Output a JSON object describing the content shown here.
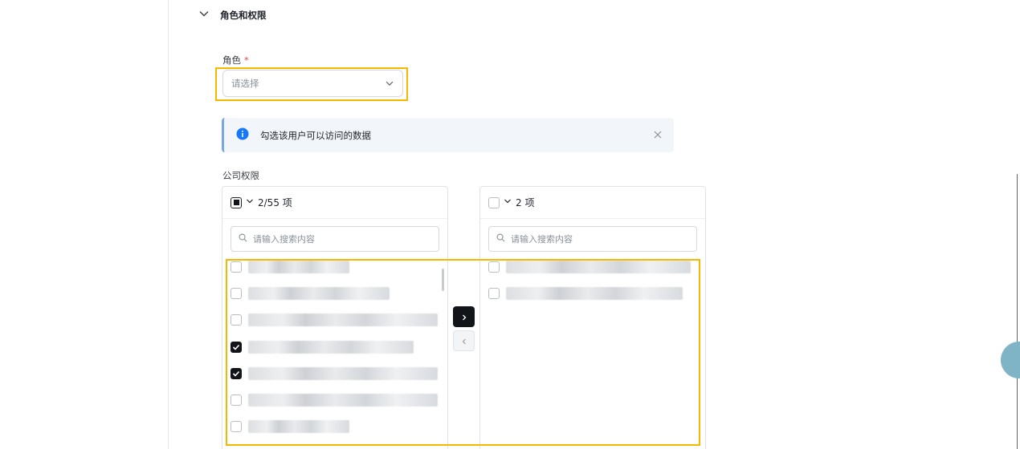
{
  "section": {
    "title": "角色和权限"
  },
  "role": {
    "label": "角色",
    "required_mark": "*",
    "placeholder": "请选择"
  },
  "alert": {
    "text": "勾选该用户可以访问的数据"
  },
  "company_permissions": {
    "label": "公司权限",
    "source": {
      "count_label": "2/55 项",
      "search_placeholder": "请输入搜索内容",
      "items": [
        {
          "checked": false
        },
        {
          "checked": false
        },
        {
          "checked": false
        },
        {
          "checked": true
        },
        {
          "checked": true
        },
        {
          "checked": false
        },
        {
          "checked": false
        }
      ]
    },
    "target": {
      "count_label": "2 项",
      "search_placeholder": "请输入搜索内容",
      "items": [
        {
          "checked": false
        },
        {
          "checked": false
        }
      ]
    }
  },
  "colors": {
    "highlight": "#f5b700",
    "primary": "#111418",
    "info": "#1677ff",
    "required": "#e5484d"
  },
  "icons": {
    "section_toggle": "chevron-down-icon",
    "select_arrow": "chevron-down-icon",
    "alert": "info-icon",
    "alert_close": "close-icon",
    "search": "search-icon",
    "move_right": "chevron-right-icon",
    "move_left": "chevron-left-icon"
  }
}
